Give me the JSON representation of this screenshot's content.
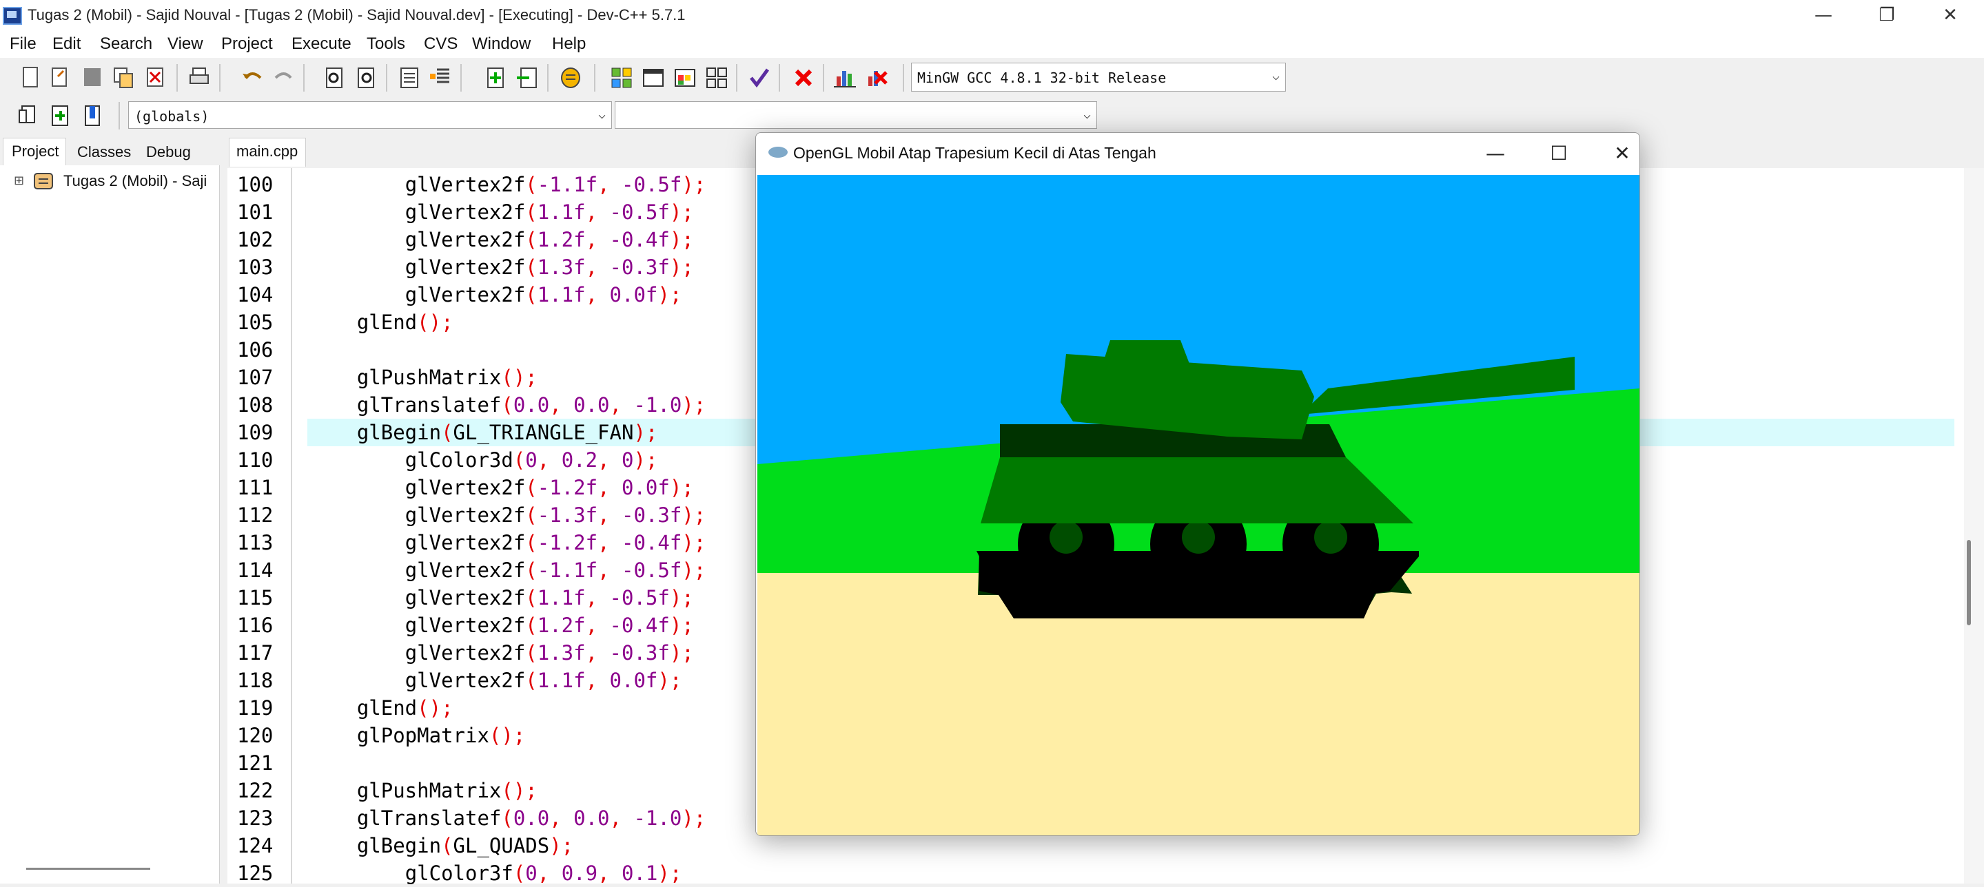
{
  "window": {
    "title": "Tugas 2 (Mobil) - Sajid Nouval - [Tugas 2 (Mobil) - Sajid Nouval.dev] - [Executing] - Dev-C++ 5.7.1",
    "minimize": "—",
    "maximize": "❐",
    "close": "✕"
  },
  "menu": [
    "File",
    "Edit",
    "Search",
    "View",
    "Project",
    "Execute",
    "Tools",
    "CVS",
    "Window",
    "Help"
  ],
  "toolbar": {
    "compiler": "MinGW GCC 4.8.1 32-bit Release",
    "scope": "(globals)",
    "function": ""
  },
  "leftpanel": {
    "tabs": [
      "Project",
      "Classes",
      "Debug"
    ],
    "tree_item": "Tugas 2 (Mobil) - Saji",
    "expander": "⊞"
  },
  "editor": {
    "tab": "main.cpp",
    "highlight_line": 109,
    "lines": [
      {
        "n": "100",
        "tokens": [
          [
            "        ",
            ""
          ],
          [
            "glVertex2f",
            "fn"
          ],
          [
            "(",
            "pu"
          ],
          [
            "-1.1f",
            "nu"
          ],
          [
            ", ",
            "pu"
          ],
          [
            "-0.5f",
            "nu"
          ],
          [
            ");",
            "pu"
          ]
        ]
      },
      {
        "n": "101",
        "tokens": [
          [
            "        ",
            ""
          ],
          [
            "glVertex2f",
            "fn"
          ],
          [
            "(",
            "pu"
          ],
          [
            "1.1f",
            "nu"
          ],
          [
            ", ",
            "pu"
          ],
          [
            "-0.5f",
            "nu"
          ],
          [
            ");",
            "pu"
          ]
        ]
      },
      {
        "n": "102",
        "tokens": [
          [
            "        ",
            ""
          ],
          [
            "glVertex2f",
            "fn"
          ],
          [
            "(",
            "pu"
          ],
          [
            "1.2f",
            "nu"
          ],
          [
            ", ",
            "pu"
          ],
          [
            "-0.4f",
            "nu"
          ],
          [
            ");",
            "pu"
          ]
        ]
      },
      {
        "n": "103",
        "tokens": [
          [
            "        ",
            ""
          ],
          [
            "glVertex2f",
            "fn"
          ],
          [
            "(",
            "pu"
          ],
          [
            "1.3f",
            "nu"
          ],
          [
            ", ",
            "pu"
          ],
          [
            "-0.3f",
            "nu"
          ],
          [
            ");",
            "pu"
          ]
        ]
      },
      {
        "n": "104",
        "tokens": [
          [
            "        ",
            ""
          ],
          [
            "glVertex2f",
            "fn"
          ],
          [
            "(",
            "pu"
          ],
          [
            "1.1f",
            "nu"
          ],
          [
            ", ",
            "pu"
          ],
          [
            "0.0f",
            "nu"
          ],
          [
            ");",
            "pu"
          ]
        ]
      },
      {
        "n": "105",
        "tokens": [
          [
            "    ",
            ""
          ],
          [
            "glEnd",
            "fn"
          ],
          [
            "();",
            "pu"
          ]
        ]
      },
      {
        "n": "106",
        "tokens": []
      },
      {
        "n": "107",
        "tokens": [
          [
            "    ",
            ""
          ],
          [
            "glPushMatrix",
            "fn"
          ],
          [
            "();",
            "pu"
          ]
        ]
      },
      {
        "n": "108",
        "tokens": [
          [
            "    ",
            ""
          ],
          [
            "glTranslatef",
            "fn"
          ],
          [
            "(",
            "pu"
          ],
          [
            "0.0",
            "nu"
          ],
          [
            ", ",
            "pu"
          ],
          [
            "0.0",
            "nu"
          ],
          [
            ", ",
            "pu"
          ],
          [
            "-1.0",
            "nu"
          ],
          [
            ");",
            "pu"
          ]
        ]
      },
      {
        "n": "109",
        "tokens": [
          [
            "    ",
            ""
          ],
          [
            "glBegin",
            "fn"
          ],
          [
            "(",
            "pu"
          ],
          [
            "GL_TRIANGLE_FAN",
            "cst"
          ],
          [
            ");",
            "pu"
          ]
        ]
      },
      {
        "n": "110",
        "tokens": [
          [
            "        ",
            ""
          ],
          [
            "glColor3d",
            "fn"
          ],
          [
            "(",
            "pu"
          ],
          [
            "0",
            "nu"
          ],
          [
            ", ",
            "pu"
          ],
          [
            "0.2",
            "nu"
          ],
          [
            ", ",
            "pu"
          ],
          [
            "0",
            "nu"
          ],
          [
            ");",
            "pu"
          ]
        ]
      },
      {
        "n": "111",
        "tokens": [
          [
            "        ",
            ""
          ],
          [
            "glVertex2f",
            "fn"
          ],
          [
            "(",
            "pu"
          ],
          [
            "-1.2f",
            "nu"
          ],
          [
            ", ",
            "pu"
          ],
          [
            "0.0f",
            "nu"
          ],
          [
            ");",
            "pu"
          ]
        ]
      },
      {
        "n": "112",
        "tokens": [
          [
            "        ",
            ""
          ],
          [
            "glVertex2f",
            "fn"
          ],
          [
            "(",
            "pu"
          ],
          [
            "-1.3f",
            "nu"
          ],
          [
            ", ",
            "pu"
          ],
          [
            "-0.3f",
            "nu"
          ],
          [
            ");",
            "pu"
          ]
        ]
      },
      {
        "n": "113",
        "tokens": [
          [
            "        ",
            ""
          ],
          [
            "glVertex2f",
            "fn"
          ],
          [
            "(",
            "pu"
          ],
          [
            "-1.2f",
            "nu"
          ],
          [
            ", ",
            "pu"
          ],
          [
            "-0.4f",
            "nu"
          ],
          [
            ");",
            "pu"
          ]
        ]
      },
      {
        "n": "114",
        "tokens": [
          [
            "        ",
            ""
          ],
          [
            "glVertex2f",
            "fn"
          ],
          [
            "(",
            "pu"
          ],
          [
            "-1.1f",
            "nu"
          ],
          [
            ", ",
            "pu"
          ],
          [
            "-0.5f",
            "nu"
          ],
          [
            ");",
            "pu"
          ]
        ]
      },
      {
        "n": "115",
        "tokens": [
          [
            "        ",
            ""
          ],
          [
            "glVertex2f",
            "fn"
          ],
          [
            "(",
            "pu"
          ],
          [
            "1.1f",
            "nu"
          ],
          [
            ", ",
            "pu"
          ],
          [
            "-0.5f",
            "nu"
          ],
          [
            ");",
            "pu"
          ]
        ]
      },
      {
        "n": "116",
        "tokens": [
          [
            "        ",
            ""
          ],
          [
            "glVertex2f",
            "fn"
          ],
          [
            "(",
            "pu"
          ],
          [
            "1.2f",
            "nu"
          ],
          [
            ", ",
            "pu"
          ],
          [
            "-0.4f",
            "nu"
          ],
          [
            ");",
            "pu"
          ]
        ]
      },
      {
        "n": "117",
        "tokens": [
          [
            "        ",
            ""
          ],
          [
            "glVertex2f",
            "fn"
          ],
          [
            "(",
            "pu"
          ],
          [
            "1.3f",
            "nu"
          ],
          [
            ", ",
            "pu"
          ],
          [
            "-0.3f",
            "nu"
          ],
          [
            ");",
            "pu"
          ]
        ]
      },
      {
        "n": "118",
        "tokens": [
          [
            "        ",
            ""
          ],
          [
            "glVertex2f",
            "fn"
          ],
          [
            "(",
            "pu"
          ],
          [
            "1.1f",
            "nu"
          ],
          [
            ", ",
            "pu"
          ],
          [
            "0.0f",
            "nu"
          ],
          [
            ");",
            "pu"
          ]
        ]
      },
      {
        "n": "119",
        "tokens": [
          [
            "    ",
            ""
          ],
          [
            "glEnd",
            "fn"
          ],
          [
            "();",
            "pu"
          ]
        ]
      },
      {
        "n": "120",
        "tokens": [
          [
            "    ",
            ""
          ],
          [
            "glPopMatrix",
            "fn"
          ],
          [
            "();",
            "pu"
          ]
        ]
      },
      {
        "n": "121",
        "tokens": []
      },
      {
        "n": "122",
        "tokens": [
          [
            "    ",
            ""
          ],
          [
            "glPushMatrix",
            "fn"
          ],
          [
            "();",
            "pu"
          ]
        ]
      },
      {
        "n": "123",
        "tokens": [
          [
            "    ",
            ""
          ],
          [
            "glTranslatef",
            "fn"
          ],
          [
            "(",
            "pu"
          ],
          [
            "0.0",
            "nu"
          ],
          [
            ", ",
            "pu"
          ],
          [
            "0.0",
            "nu"
          ],
          [
            ", ",
            "pu"
          ],
          [
            "-1.0",
            "nu"
          ],
          [
            ");",
            "pu"
          ]
        ]
      },
      {
        "n": "124",
        "tokens": [
          [
            "    ",
            ""
          ],
          [
            "glBegin",
            "fn"
          ],
          [
            "(",
            "pu"
          ],
          [
            "GL_QUADS",
            "cst"
          ],
          [
            ");",
            "pu"
          ]
        ]
      },
      {
        "n": "125",
        "tokens": [
          [
            "        ",
            ""
          ],
          [
            "glColor3f",
            "fn"
          ],
          [
            "(",
            "pu"
          ],
          [
            "0",
            "nu"
          ],
          [
            ", ",
            "pu"
          ],
          [
            "0.9",
            "nu"
          ],
          [
            ", ",
            "pu"
          ],
          [
            "0.1",
            "nu"
          ],
          [
            ");",
            "pu"
          ]
        ]
      }
    ]
  },
  "glwindow": {
    "title": "OpenGL Mobil Atap Trapesium Kecil di Atas Tengah",
    "minimize": "—",
    "maximize": "☐",
    "close": "✕",
    "colors": {
      "sky": "#00aaff",
      "grass": "#00dd1a",
      "sand": "#ffeea6",
      "tank_body": "#007a00",
      "tank_dark": "#003300",
      "track": "#000000",
      "wheel_hub": "#004d00"
    }
  }
}
